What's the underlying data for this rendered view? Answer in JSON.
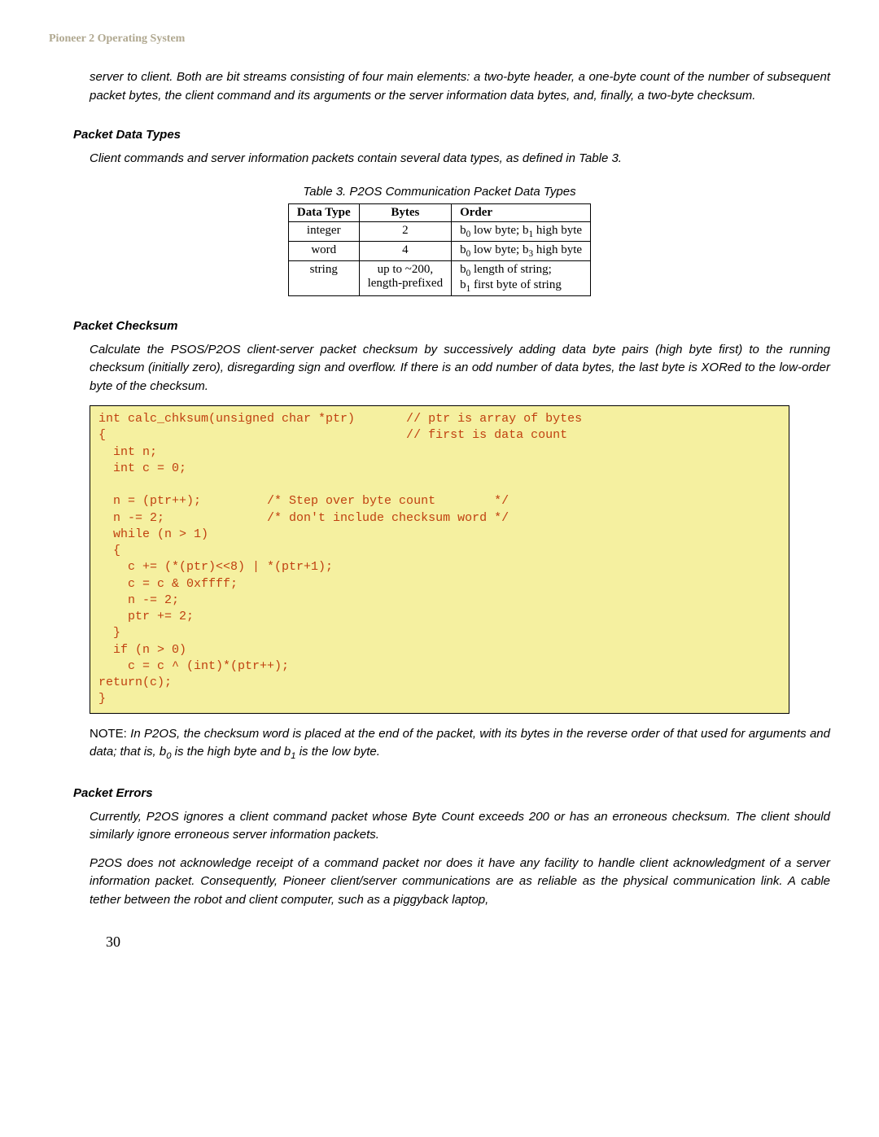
{
  "header": "Pioneer 2 Operating System",
  "intro_para": "server to client.  Both are bit streams consisting of four main elements:  a two-byte header, a one-byte count of the number of subsequent packet bytes, the client command and its arguments or the server information data bytes, and, finally, a two-byte checksum.",
  "sec1": {
    "title": "Packet Data Types",
    "para": "Client commands and server information packets contain several data types, as defined in Table 3.",
    "table_caption": "Table 3. P2OS Communication Packet Data Types",
    "table": {
      "headers": [
        "Data Type",
        "Bytes",
        "Order"
      ],
      "rows": [
        {
          "dt": "integer",
          "bytes": "2",
          "order_a": "b",
          "order_a_sub": "0",
          "order_a_text": " low byte; b",
          "order_b_sub": "1",
          "order_b_text": " high byte"
        },
        {
          "dt": "word",
          "bytes": "4",
          "order_a": "b",
          "order_a_sub": "0",
          "order_a_text": " low byte; b",
          "order_b_sub": "3",
          "order_b_text": " high byte"
        },
        {
          "dt": "string",
          "bytes_l1": "up to ~200,",
          "bytes_l2": "length-prefixed",
          "order_l1_a": "b",
          "order_l1_sub": "0",
          "order_l1_text": " length of string;",
          "order_l2_a": "b",
          "order_l2_sub": "1",
          "order_l2_text": " first byte of string"
        }
      ]
    }
  },
  "sec2": {
    "title": "Packet Checksum",
    "para": "Calculate the PSOS/P2OS client-server packet checksum by successively adding data byte pairs (high byte first) to the running checksum (initially zero), disregarding sign and overflow.   If there is an odd number of data bytes, the last byte is XORed to the low-order byte of the checksum.",
    "code": "int calc_chksum(unsigned char *ptr)       // ptr is array of bytes\n{                                         // first is data count\n  int n;\n  int c = 0;\n\n  n = (ptr++);         /* Step over byte count        */\n  n -= 2;              /* don't include checksum word */\n  while (n > 1)\n  {\n    c += (*(ptr)<<8) | *(ptr+1);\n    c = c & 0xffff;\n    n -= 2;\n    ptr += 2;\n  }\n  if (n > 0)\n    c = c ^ (int)*(ptr++);\nreturn(c);\n}",
    "note_label": "NOTE:",
    "note_text_a": "  In P2OS, the checksum word is placed at the end of the packet, with its bytes in the reverse order of that used for arguments and data; that is, b",
    "note_sub0": "0",
    "note_text_b": " is the high byte and b",
    "note_sub1": "1",
    "note_text_c": " is the low byte."
  },
  "sec3": {
    "title": "Packet Errors",
    "para1": "Currently, P2OS ignores a client command packet whose Byte Count exceeds 200 or has an erroneous checksum.  The client should similarly ignore erroneous server information packets.",
    "para2": "P2OS does not acknowledge receipt of a command packet nor does it have any facility to handle client acknowledgment of a server information packet. Consequently, Pioneer client/server communications are as reliable as the physical communication link.  A cable tether between the robot and client computer, such as a piggyback laptop,"
  },
  "pagenum": "30"
}
